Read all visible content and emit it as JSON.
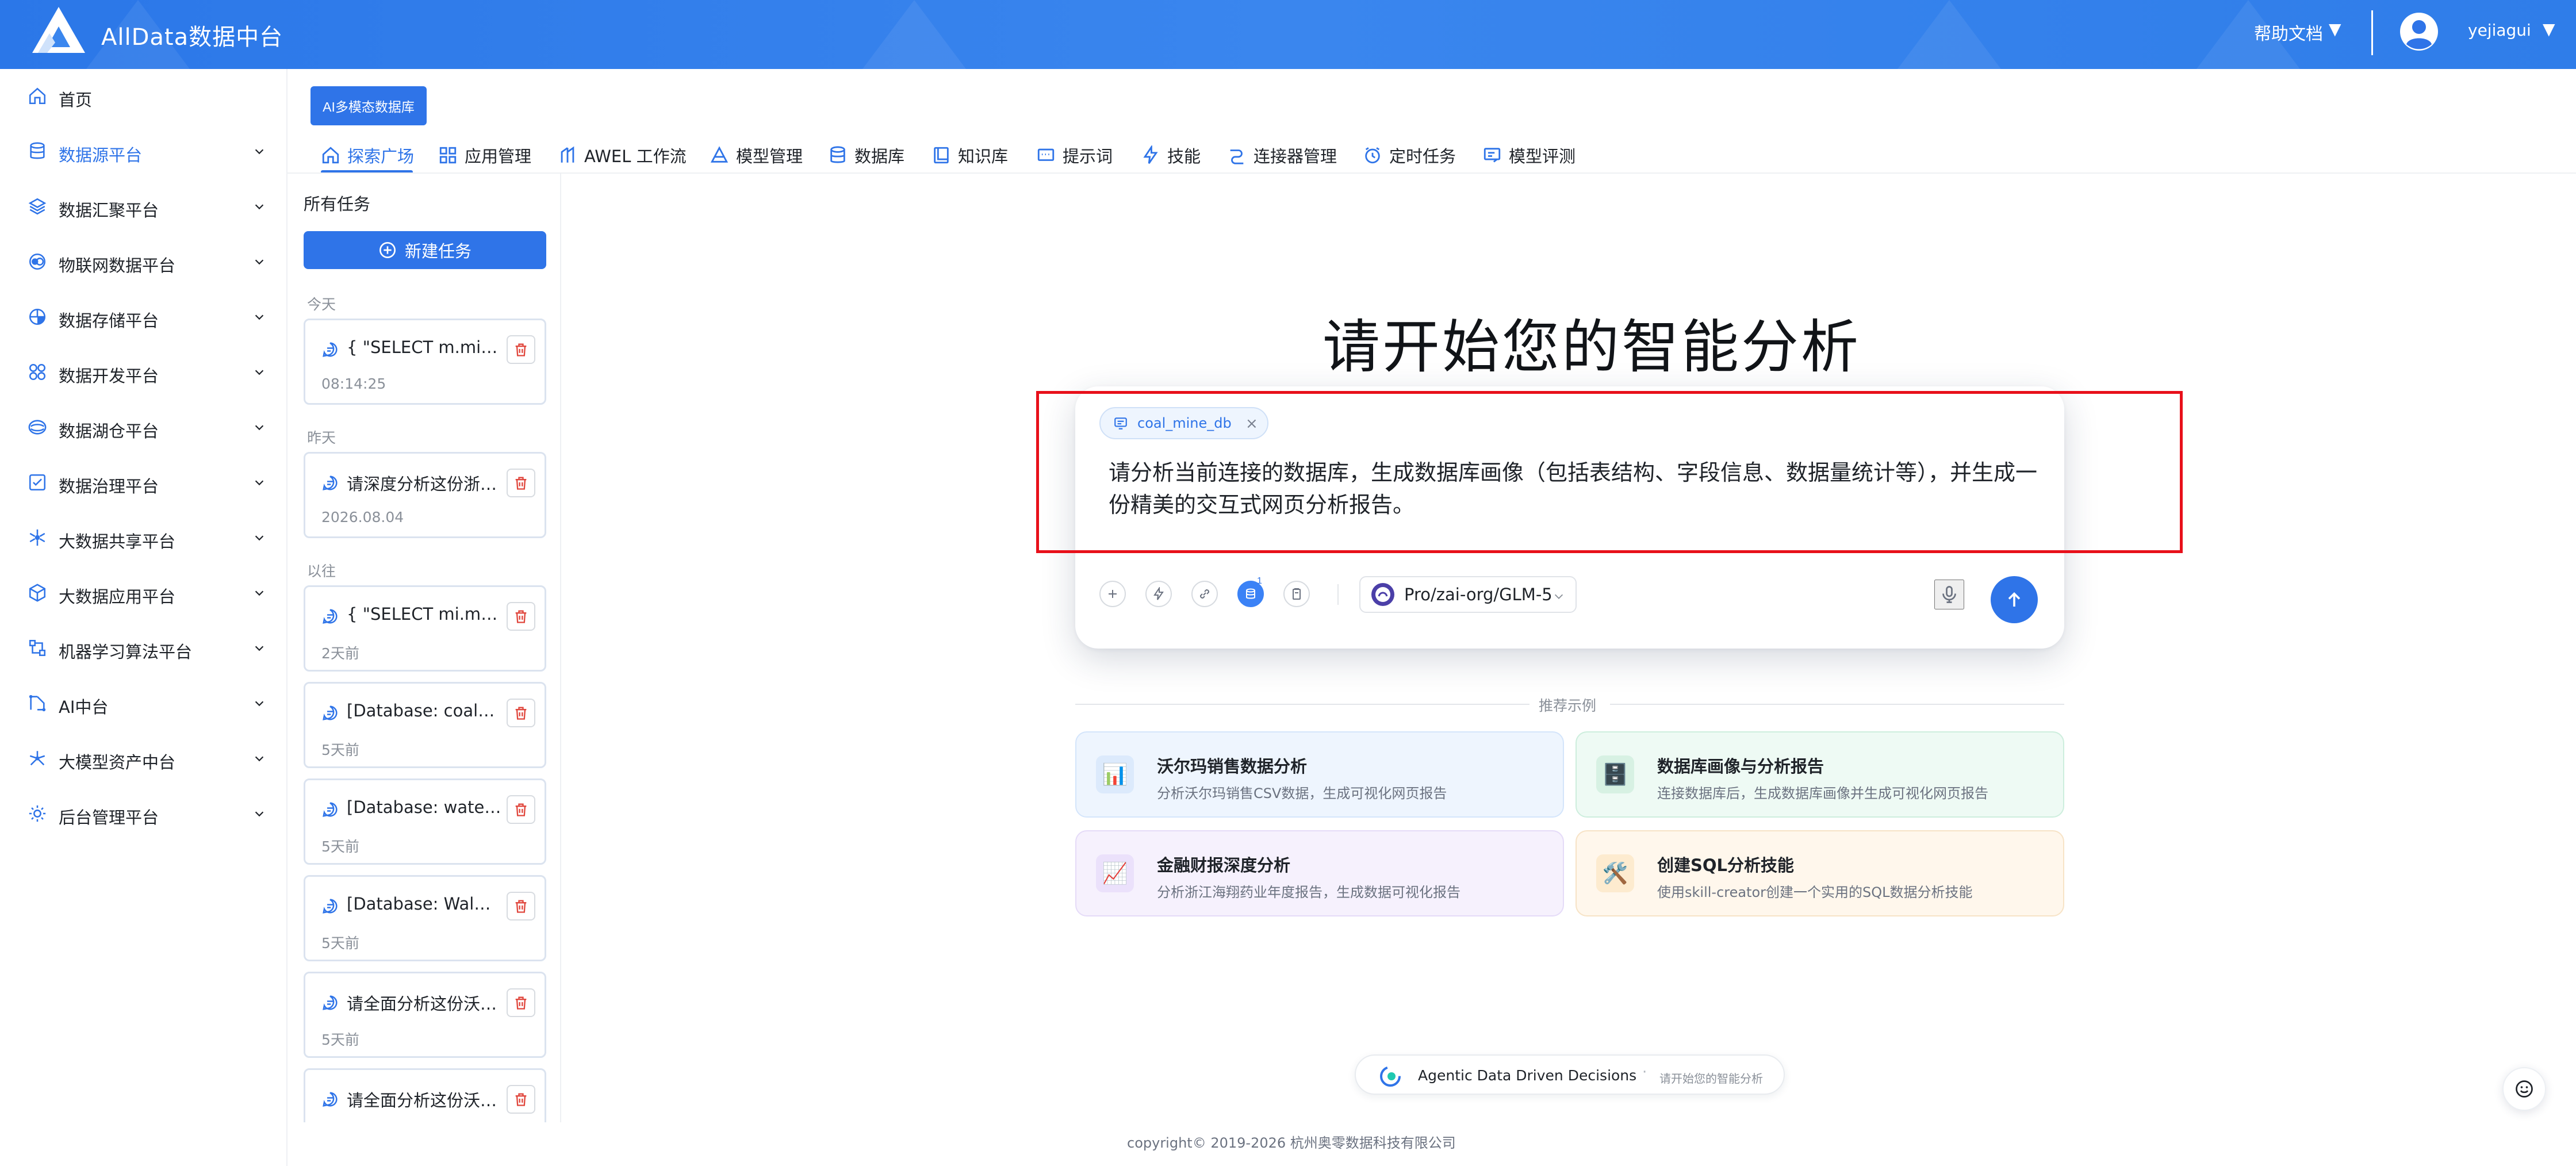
{
  "app": {
    "title": "AllData数据中台"
  },
  "header": {
    "help_label": "帮助文档",
    "help_arrow": "▼",
    "username": "yejiagui",
    "user_arrow": "▼"
  },
  "sidebar": {
    "items": [
      {
        "label": "首页",
        "icon": "home-icon"
      },
      {
        "label": "数据源平台",
        "icon": "database-icon"
      },
      {
        "label": "数据汇聚平台",
        "icon": "layers-icon"
      },
      {
        "label": "物联网数据平台",
        "icon": "iot-icon"
      },
      {
        "label": "数据存储平台",
        "icon": "storage-icon"
      },
      {
        "label": "数据开发平台",
        "icon": "grid-icon"
      },
      {
        "label": "数据湖仓平台",
        "icon": "lake-icon"
      },
      {
        "label": "数据治理平台",
        "icon": "checklist-icon"
      },
      {
        "label": "大数据共享平台",
        "icon": "share-icon"
      },
      {
        "label": "大数据应用平台",
        "icon": "cube-icon"
      },
      {
        "label": "机器学习算法平台",
        "icon": "ml-icon"
      },
      {
        "label": "AI中台",
        "icon": "ai-icon"
      },
      {
        "label": "大模型资产中台",
        "icon": "model-asset-icon"
      },
      {
        "label": "后台管理平台",
        "icon": "admin-icon"
      }
    ]
  },
  "top_tag": {
    "label": "AI多模态数据库"
  },
  "nav": {
    "tabs": [
      {
        "label": "探索广场",
        "icon": "home-icon"
      },
      {
        "label": "应用管理",
        "icon": "apps-icon"
      },
      {
        "label": "AWEL 工作流",
        "icon": "workflow-icon"
      },
      {
        "label": "模型管理",
        "icon": "model-icon"
      },
      {
        "label": "数据库",
        "icon": "database-icon"
      },
      {
        "label": "知识库",
        "icon": "book-icon"
      },
      {
        "label": "提示词",
        "icon": "prompt-icon"
      },
      {
        "label": "技能",
        "icon": "bolt-icon"
      },
      {
        "label": "连接器管理",
        "icon": "connector-icon"
      },
      {
        "label": "定时任务",
        "icon": "clock-icon"
      },
      {
        "label": "模型评测",
        "icon": "evaluate-icon"
      }
    ]
  },
  "tasks": {
    "title": "所有任务",
    "new_button": "新建任务",
    "groups": [
      {
        "label": "今天",
        "items": [
          {
            "title": "{ \"SELECT m.mine_name, m.address\"",
            "time": "08:14:25"
          }
        ]
      },
      {
        "label": "昨天",
        "items": [
          {
            "title": "请深度分析这份浙江海翔药业年度报告",
            "time": "2026.08.04"
          }
        ]
      },
      {
        "label": "以往",
        "items": [
          {
            "title": "{ \"SELECT mi.mine_name\"",
            "time": "2天前"
          },
          {
            "title": "[Database: coal_mine_db]",
            "time": "5天前"
          },
          {
            "title": "[Database: water_quality]",
            "time": "5天前"
          },
          {
            "title": "[Database: Walmart_sales]",
            "time": "5天前"
          },
          {
            "title": "请全面分析这份沃尔玛销售数据",
            "time": "5天前"
          },
          {
            "title": "请全面分析这份沃尔玛销售数据",
            "time": ""
          }
        ]
      }
    ]
  },
  "main": {
    "hero_title": "请开始您的智能分析",
    "chip": {
      "label": "coal_mine_db",
      "close": "×"
    },
    "prompt": "请分析当前连接的数据库，生成数据库画像（包括表结构、字段信息、数据量统计等），并生成一份精美的交互式网页分析报告。",
    "tool_badge": "1",
    "model": {
      "label": "Pro/zai-org/GLM-5"
    }
  },
  "examples": {
    "label": "推荐示例",
    "cards": [
      {
        "title": "沃尔玛销售数据分析",
        "desc": "分析沃尔玛销售CSV数据，生成可视化网页报告",
        "icon": "📊",
        "bg": "#eef5fe",
        "border": "#d4e5fb",
        "iconbg": "#dceafc"
      },
      {
        "title": "数据库画像与分析报告",
        "desc": "连接数据库后，生成数据库画像并生成可视化网页报告",
        "icon": "🗄️",
        "bg": "#eefaf4",
        "border": "#cdeedd",
        "iconbg": "#d7f1e3"
      },
      {
        "title": "金融财报深度分析",
        "desc": "分析浙江海翔药业年度报告，生成数据可视化报告",
        "icon": "📈",
        "bg": "#f6f1fd",
        "border": "#e5dbf8",
        "iconbg": "#ebe1fb"
      },
      {
        "title": "创建SQL分析技能",
        "desc": "使用skill-creator创建一个实用的SQL数据分析技能",
        "icon": "🛠️",
        "bg": "#fff7ec",
        "border": "#f7e3c6",
        "iconbg": "#fdebcf"
      }
    ]
  },
  "footer": {
    "pill_title": "Agentic Data Driven Decisions",
    "pill_dot": "·",
    "pill_sub": "请开始您的智能分析",
    "copyright": "copyright© 2019-2026 杭州奥零数据科技有限公司"
  },
  "colors": {
    "primary": "#2f74e8",
    "highlight": "#e8101a"
  }
}
